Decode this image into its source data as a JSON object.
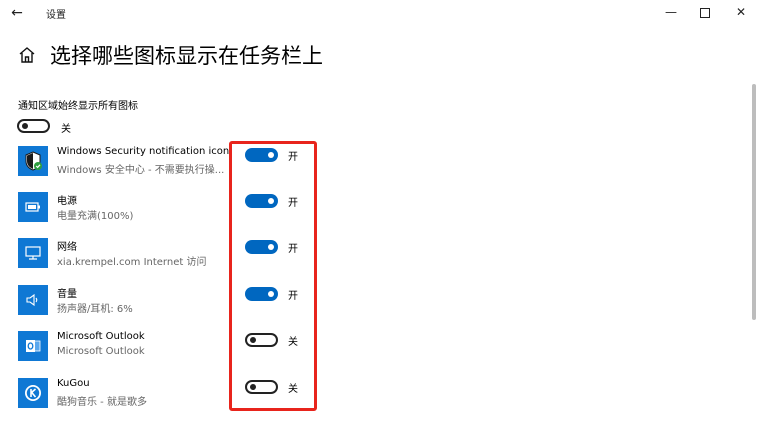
{
  "window": {
    "title": "设置",
    "back_icon": "back-arrow-icon",
    "min_label": "—",
    "close_label": "✕"
  },
  "page": {
    "title": "选择哪些图标显示在任务栏上"
  },
  "master": {
    "label": "通知区域始终显示所有图标",
    "state_label": "关",
    "on": false
  },
  "items": [
    {
      "name": "Windows Security notification icon",
      "desc": "Windows 安全中心 - 不需要执行操...",
      "state_label": "开",
      "on": true,
      "icon": "shield-icon"
    },
    {
      "name": "电源",
      "desc": "电量充满(100%)",
      "state_label": "开",
      "on": true,
      "icon": "battery-icon"
    },
    {
      "name": "网络",
      "desc": "xia.krempel.com Internet 访问",
      "state_label": "开",
      "on": true,
      "icon": "network-icon"
    },
    {
      "name": "音量",
      "desc": "扬声器/耳机: 6%",
      "state_label": "开",
      "on": true,
      "icon": "speaker-icon"
    },
    {
      "name": "Microsoft Outlook",
      "desc": "Microsoft Outlook",
      "state_label": "关",
      "on": false,
      "icon": "outlook-icon"
    },
    {
      "name": "KuGou",
      "desc": "酷狗音乐 - 就是歌多",
      "state_label": "关",
      "on": false,
      "icon": "kugou-icon"
    }
  ],
  "colors": {
    "accent": "#0067c0",
    "icon_tile": "#0f78d4",
    "highlight": "#e8241c"
  }
}
